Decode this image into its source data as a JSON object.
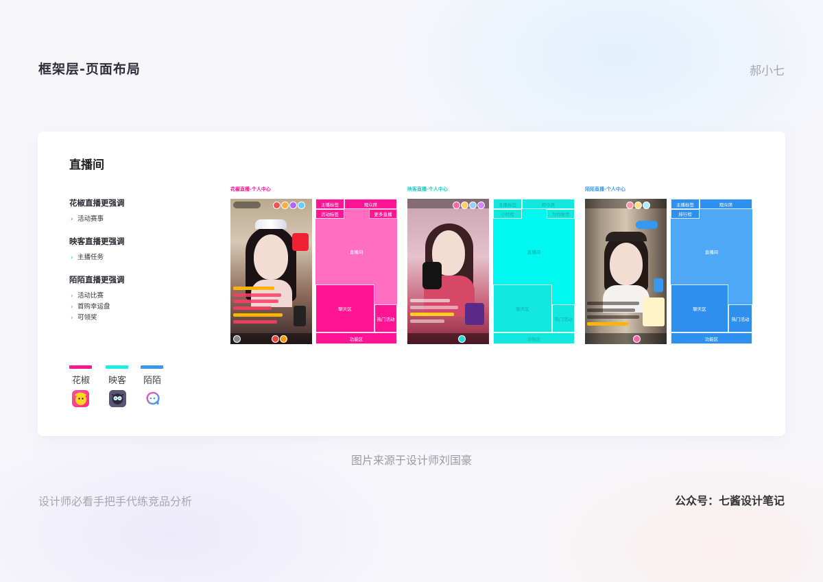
{
  "header": {
    "title": "框架层-页面布局",
    "author": "郝小七"
  },
  "card": {
    "title": "直播间",
    "sections": [
      {
        "heading": "花椒直播更强调",
        "items": [
          "活动赛事"
        ]
      },
      {
        "heading": "映客直播更强调",
        "items": [
          "主播任务"
        ]
      },
      {
        "heading": "陌陌直播更强调",
        "items": [
          "活动比赛",
          "首购幸运盘",
          "可领奖"
        ]
      }
    ],
    "legend": [
      {
        "name": "花椒",
        "color": "#ff1493"
      },
      {
        "name": "映客",
        "color": "#19eee2"
      },
      {
        "name": "陌陌",
        "color": "#3798f0"
      }
    ],
    "phones": [
      {
        "label": "花椒直播-个人中心",
        "color": "#ff1493",
        "layout_color": "#ff6ec0",
        "blocks": {
          "host_tag": "主播标签",
          "audience": "观众席",
          "activity_tag": "活动标签",
          "more_live": "更多直播",
          "live_room": "直播间",
          "chat": "聊天区",
          "hot_event": "热门活动",
          "function": "功能区"
        }
      },
      {
        "label": "映客直播-个人中心",
        "color": "#19eee2",
        "layout_color": "#00f8f0",
        "blocks": {
          "host_tag": "主播标签",
          "audience": "观众席",
          "hourly_rank": "小时榜",
          "recommend": "为你推荐",
          "live_room": "直播间",
          "chat": "聊天区",
          "hot_event": "热门活动",
          "function": "功能区"
        }
      },
      {
        "label": "陌陌直播-个人中心",
        "color": "#3798f0",
        "layout_color": "#4ea7f7",
        "blocks": {
          "host_tag": "主播标签",
          "audience": "观众席",
          "rank": "排行榜",
          "live_room": "直播间",
          "chat": "聊天区",
          "hot_event": "热门活动",
          "function": "功能区"
        }
      }
    ]
  },
  "caption": "图片来源于设计师刘国豪",
  "footer": {
    "left": "设计师必看手把手代练竞品分析",
    "right": "公众号：七酱设计笔记"
  }
}
